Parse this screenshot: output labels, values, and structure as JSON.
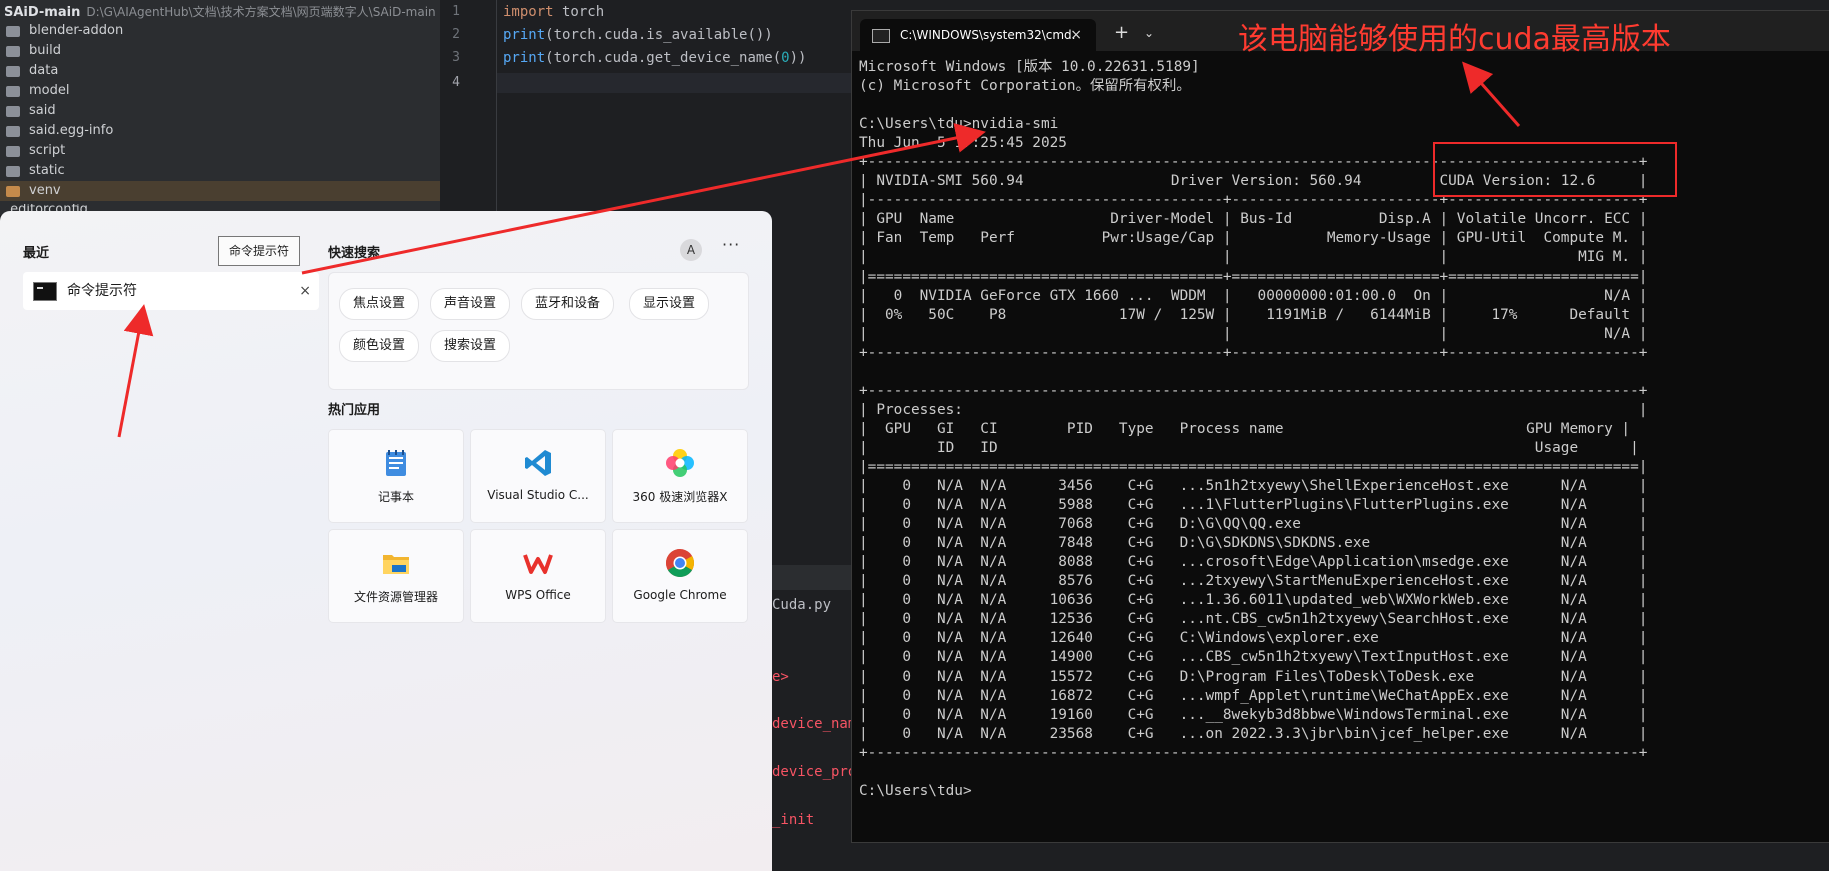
{
  "ide": {
    "project_name": "SAiD-main",
    "project_path": "D:\\G\\AIAgentHub\\文档\\技术方案文档\\网页端数字人\\SAiD-main",
    "tree": [
      {
        "label": "blender-addon"
      },
      {
        "label": "build"
      },
      {
        "label": "data"
      },
      {
        "label": "model"
      },
      {
        "label": "said"
      },
      {
        "label": "said.egg-info"
      },
      {
        "label": "script"
      },
      {
        "label": "static"
      },
      {
        "label": "venv"
      }
    ],
    "tree_partial": ".editorconfig",
    "line_numbers": [
      "1",
      "2",
      "3",
      "4"
    ],
    "code_lines": [
      {
        "kw": "import",
        "rest": " torch"
      },
      {
        "fn": "print",
        "rest": "(torch.cuda.is_available())"
      },
      {
        "fn": "print",
        "rest": "(torch.cuda.get_device_name(",
        "num": "0",
        "tail": "))"
      }
    ],
    "lower_peeks": {
      "file": "Cuda.py",
      "p1": "e>",
      "p2": "device_name",
      "p3": "device_prop",
      "p4": "_init"
    }
  },
  "start_menu": {
    "recent_title": "最近",
    "recent_tooltip": "命令提示符",
    "recent_item": "命令提示符",
    "recent_close": "×",
    "quick_title": "快速搜索",
    "avatar": "A",
    "more": "···",
    "quick_chips": [
      "焦点设置",
      "声音设置",
      "蓝牙和设备",
      "显示设置",
      "颜色设置",
      "搜索设置"
    ],
    "hot_title": "热门应用",
    "apps": [
      {
        "name": "记事本",
        "icon": "notepad-icon"
      },
      {
        "name": "Visual Studio C...",
        "icon": "vscode-icon"
      },
      {
        "name": "360 极速浏览器X",
        "icon": "360-browser-icon"
      },
      {
        "name": "文件资源管理器",
        "icon": "file-explorer-icon"
      },
      {
        "name": "WPS Office",
        "icon": "wps-icon"
      },
      {
        "name": "Google Chrome",
        "icon": "chrome-icon"
      }
    ]
  },
  "terminal": {
    "tab_title": "C:\\WINDOWS\\system32\\cmd.",
    "tab_close": "×",
    "new_tab": "+",
    "dropdown": "⌄",
    "lines": [
      "Microsoft Windows [版本 10.0.22631.5189]",
      "(c) Microsoft Corporation。保留所有权利。",
      "",
      "C:\\Users\\tdu>nvidia-smi",
      "Thu Jun  5 17:25:45 2025",
      "+-----------------------------------------------------------------------------------------+",
      "| NVIDIA-SMI 560.94                 Driver Version: 560.94         CUDA Version: 12.6     |",
      "|-----------------------------------------+------------------------+----------------------+",
      "| GPU  Name                  Driver-Model | Bus-Id          Disp.A | Volatile Uncorr. ECC |",
      "| Fan  Temp   Perf          Pwr:Usage/Cap |           Memory-Usage | GPU-Util  Compute M. |",
      "|                                         |                        |               MIG M. |",
      "|=========================================+========================+======================|",
      "|   0  NVIDIA GeForce GTX 1660 ...  WDDM  |   00000000:01:00.0  On |                  N/A |",
      "|  0%   50C    P8             17W /  125W |    1191MiB /   6144MiB |     17%      Default |",
      "|                                         |                        |                  N/A |",
      "+-----------------------------------------+------------------------+----------------------+",
      "",
      "+-----------------------------------------------------------------------------------------+",
      "| Processes:                                                                              |",
      "|  GPU   GI   CI        PID   Type   Process name                            GPU Memory |",
      "|        ID   ID                                                              Usage      |",
      "|=========================================================================================|",
      "|    0   N/A  N/A      3456    C+G   ...5n1h2txyewy\\ShellExperienceHost.exe      N/A      |",
      "|    0   N/A  N/A      5988    C+G   ...1\\FlutterPlugins\\FlutterPlugins.exe      N/A      |",
      "|    0   N/A  N/A      7068    C+G   D:\\G\\QQ\\QQ.exe                              N/A      |",
      "|    0   N/A  N/A      7848    C+G   D:\\G\\SDKDNS\\SDKDNS.exe                      N/A      |",
      "|    0   N/A  N/A      8088    C+G   ...crosoft\\Edge\\Application\\msedge.exe      N/A      |",
      "|    0   N/A  N/A      8576    C+G   ...2txyewy\\StartMenuExperienceHost.exe      N/A      |",
      "|    0   N/A  N/A     10636    C+G   ...1.36.6011\\updated_web\\WXWorkWeb.exe      N/A      |",
      "|    0   N/A  N/A     12536    C+G   ...nt.CBS_cw5n1h2txyewy\\SearchHost.exe      N/A      |",
      "|    0   N/A  N/A     12640    C+G   C:\\Windows\\explorer.exe                     N/A      |",
      "|    0   N/A  N/A     14900    C+G   ...CBS_cw5n1h2txyewy\\TextInputHost.exe      N/A      |",
      "|    0   N/A  N/A     15572    C+G   D:\\Program Files\\ToDesk\\ToDesk.exe          N/A      |",
      "|    0   N/A  N/A     16872    C+G   ...wmpf_Applet\\runtime\\WeChatAppEx.exe      N/A      |",
      "|    0   N/A  N/A     19160    C+G   ...__8wekyb3d8bbwe\\WindowsTerminal.exe      N/A      |",
      "|    0   N/A  N/A     23568    C+G   ...on 2022.3.3\\jbr\\bin\\jcef_helper.exe      N/A      |",
      "+-----------------------------------------------------------------------------------------+",
      "",
      "C:\\Users\\tdu>"
    ]
  },
  "annotation": {
    "caption": "该电脑能够使用的cuda最高版本",
    "color": "#ee2a2a"
  }
}
